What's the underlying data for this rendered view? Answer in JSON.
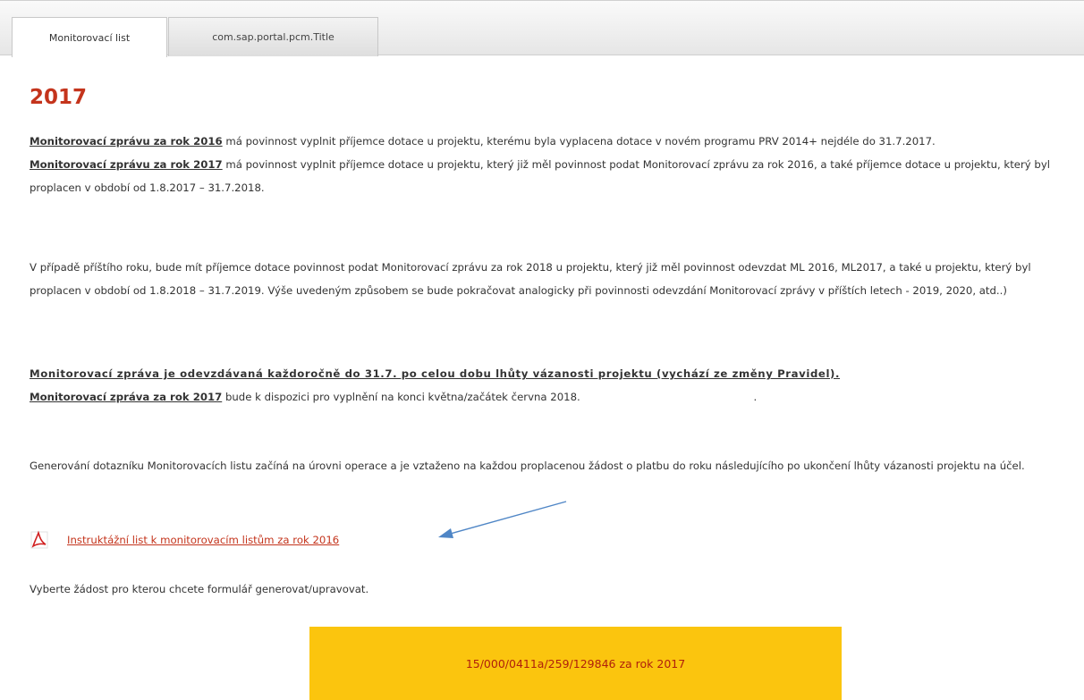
{
  "tabs": [
    {
      "label": "Monitorovací list",
      "active": true
    },
    {
      "label": "com.sap.portal.pcm.Title",
      "active": false
    }
  ],
  "heading": "2017",
  "p1": {
    "a_bold": "Monitorovací zprávu za rok 2016",
    "a_text": " má povinnost vyplnit příjemce dotace u projektu, kterému byla vyplacena dotace v novém programu PRV 2014+ nejdéle do 31.7.2017.",
    "b_bold": "Monitorovací zprávu za rok 2017",
    "b_text": " má povinnost vyplnit příjemce dotace u projektu, který již měl povinnost podat Monitorovací zprávu za rok 2016, a také příjemce dotace u projektu, který byl proplacen v období od 1.8.2017 – 31.7.2018."
  },
  "p2": "V případě příštího roku, bude mít příjemce dotace povinnost podat Monitorovací zprávu za rok 2018 u projektu, který již měl povinnost odevzdat ML 2016, ML2017, a také u projektu, který byl proplacen v období od 1.8.2018 – 31.7.2019. Výše uvedeným způsobem se bude pokračovat analogicky při povinnosti odevzdání Monitorovací zprávy v příštích letech - 2019, 2020, atd..)",
  "p3": {
    "a_bold": "Monitorovací zpráva je odevzdávaná každoročně do 31.7. po celou dobu lhůty vázanosti projektu (vychází ze změny Pravidel).",
    "b_bold": "Monitorovací zpráva za rok 2017",
    "b_text": " bude k dispozici pro vyplnění na konci května/začátek června 2018.",
    "dot": "."
  },
  "p4": "Generování dotazníku Monitorovacích listu začíná na úrovni operace a je vztaženo na každou proplacenou žádost o platbu do roku následujícího po ukončení lhůty vázanosti projektu na účel.",
  "pdf_link": "Instruktážní list k monitorovacím listům za rok 2016",
  "select_note": "Vyberte žádost pro kterou chcete formulář generovat/upravovat.",
  "application_button": "15/000/0411a/259/129846 za rok 2017",
  "colors": {
    "accent": "#c4341c",
    "button": "#fbc50e",
    "arrow": "#4f86c6"
  }
}
